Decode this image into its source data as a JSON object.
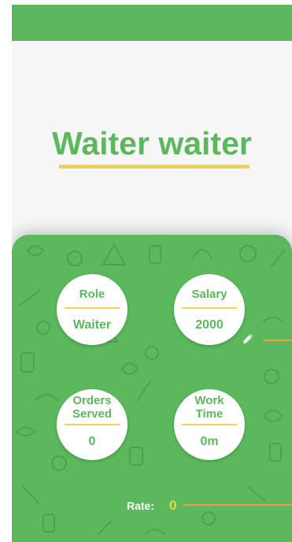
{
  "header": {
    "title": "Waiter waiter"
  },
  "stats": {
    "role": {
      "label": "Role",
      "value": "Waiter"
    },
    "salary": {
      "label": "Salary",
      "value": "2000"
    },
    "orders": {
      "label": "Orders Served",
      "value": "0"
    },
    "work": {
      "label": "Work Time",
      "value": "0m"
    }
  },
  "rating": {
    "label": "Rate:",
    "value": "0"
  },
  "icons": {
    "edit": "pencil-icon"
  },
  "colors": {
    "brand_green": "#5cb85c",
    "accent_yellow": "#f2d34d",
    "accent_orange": "#f0a040",
    "background": "#f7f7f7"
  }
}
